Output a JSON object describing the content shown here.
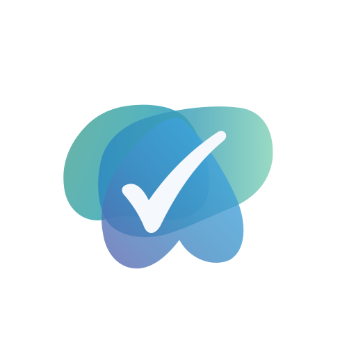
{
  "logo": {
    "icon": "checkmark-icon",
    "colors": {
      "teal": "#5fb3a0",
      "green": "#7ed0b8",
      "blue": "#2a9fd8",
      "light_blue": "#40b0e8",
      "purple": "#5a68b0",
      "check": "#f5f8fc",
      "background": "#ffffff"
    }
  }
}
